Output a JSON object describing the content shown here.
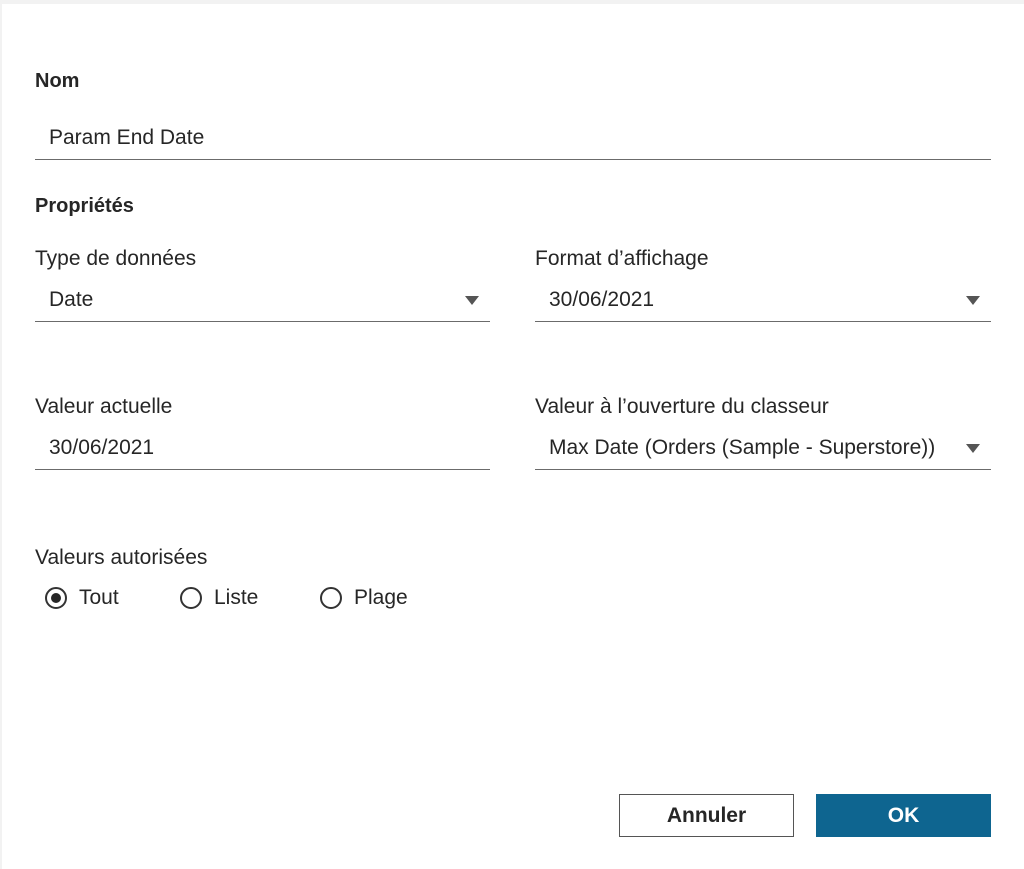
{
  "name_section": {
    "label": "Nom",
    "value": "Param End Date"
  },
  "properties_section": {
    "label": "Propriétés",
    "data_type": {
      "label": "Type de données",
      "value": "Date"
    },
    "display_format": {
      "label": "Format d’affichage",
      "value": "30/06/2021"
    },
    "current_value": {
      "label": "Valeur actuelle",
      "value": "30/06/2021"
    },
    "workbook_open_value": {
      "label": "Valeur à l’ouverture du classeur",
      "value": "Max Date (Orders (Sample - Superstore))"
    }
  },
  "allowed_values": {
    "label": "Valeurs autorisées",
    "options": [
      {
        "label": "Tout",
        "checked": true
      },
      {
        "label": "Liste",
        "checked": false
      },
      {
        "label": "Plage",
        "checked": false
      }
    ]
  },
  "buttons": {
    "cancel": "Annuler",
    "ok": "OK"
  },
  "colors": {
    "primary_button": "#0e6590",
    "underline": "#6b6b6b"
  }
}
